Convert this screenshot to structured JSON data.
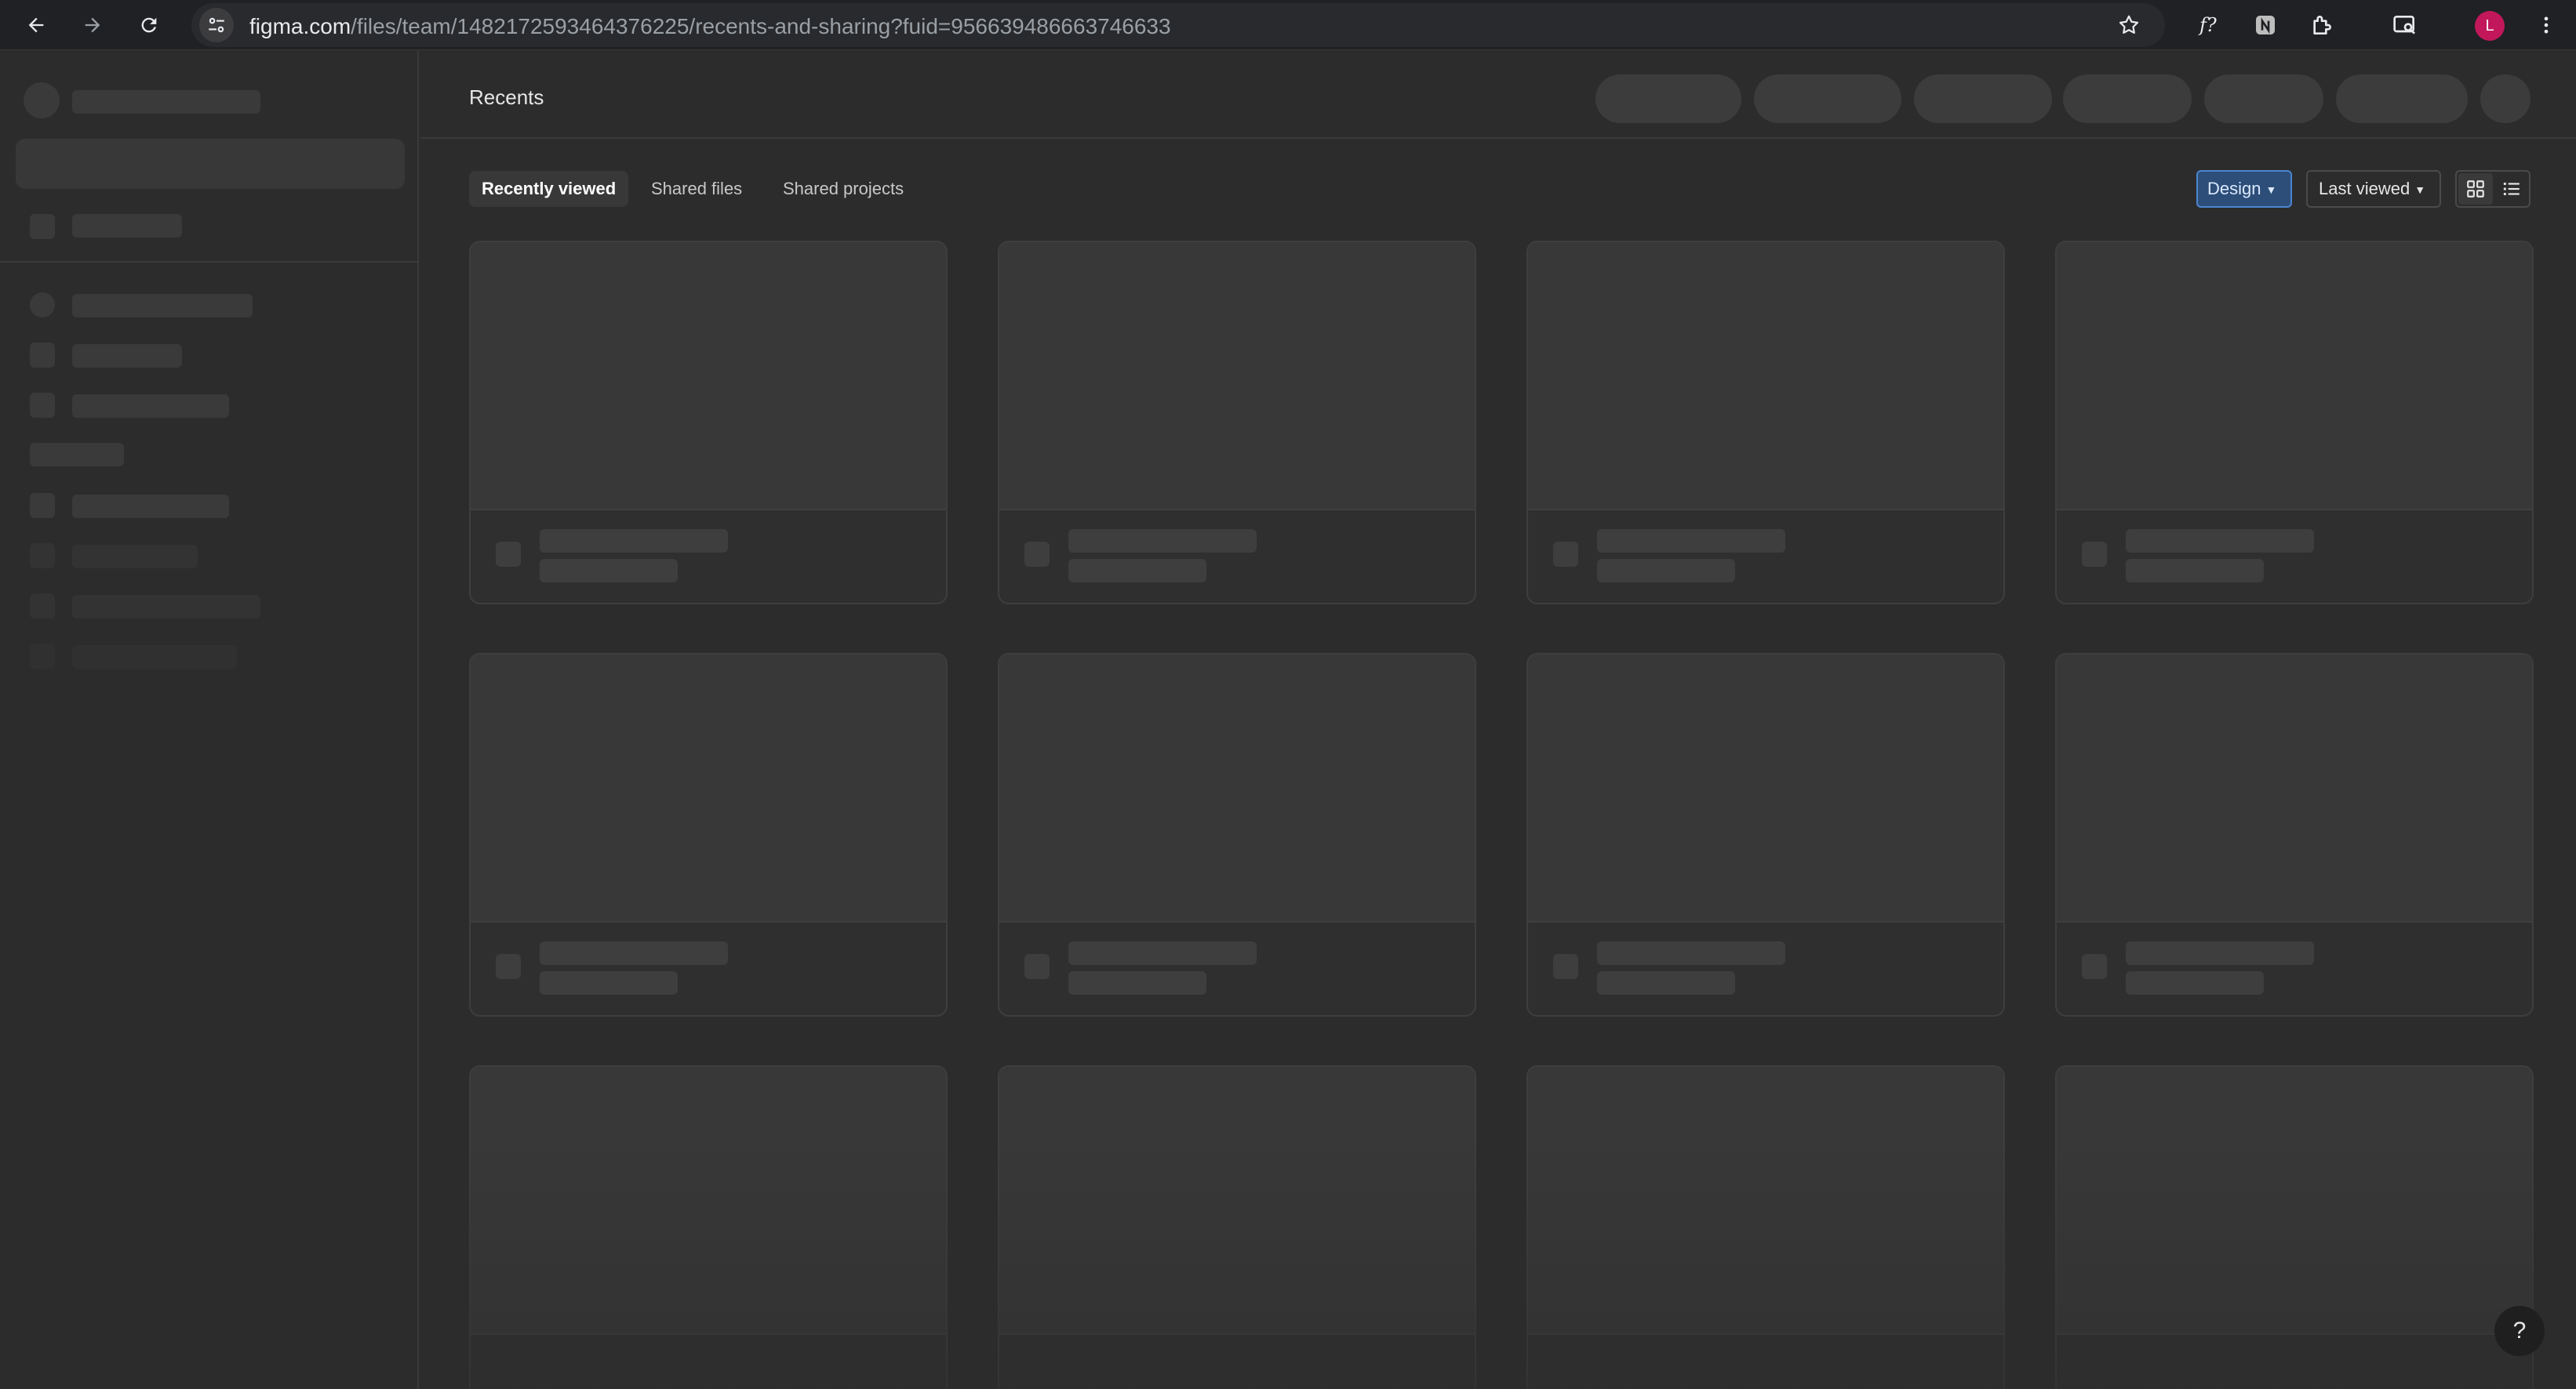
{
  "browser": {
    "url_host": "figma.com",
    "url_path": "/files/team/1482172593464376225/recents-and-sharing?fuid=956639486663746633",
    "profile_initial": "L",
    "icons": [
      "back-arrow-icon",
      "forward-arrow-icon",
      "reload-icon",
      "site-info-icon",
      "bookmark-star-icon",
      "figma-extension-icon",
      "grammar-extension-icon",
      "extensions-puzzle-icon",
      "tab-search-icon",
      "kebab-menu-icon"
    ],
    "colors": {
      "profile": "#c2185b",
      "bar": "#202124"
    }
  },
  "main": {
    "title": "Recents",
    "tabs": [
      {
        "label": "Recently viewed",
        "active": true
      },
      {
        "label": "Shared files",
        "active": false
      },
      {
        "label": "Shared projects",
        "active": false
      }
    ],
    "filter_label": "Design",
    "sort_label": "Last viewed",
    "view_mode": "grid",
    "help_label": "?",
    "accent_color": "#4a86d2"
  },
  "loading_state": true
}
